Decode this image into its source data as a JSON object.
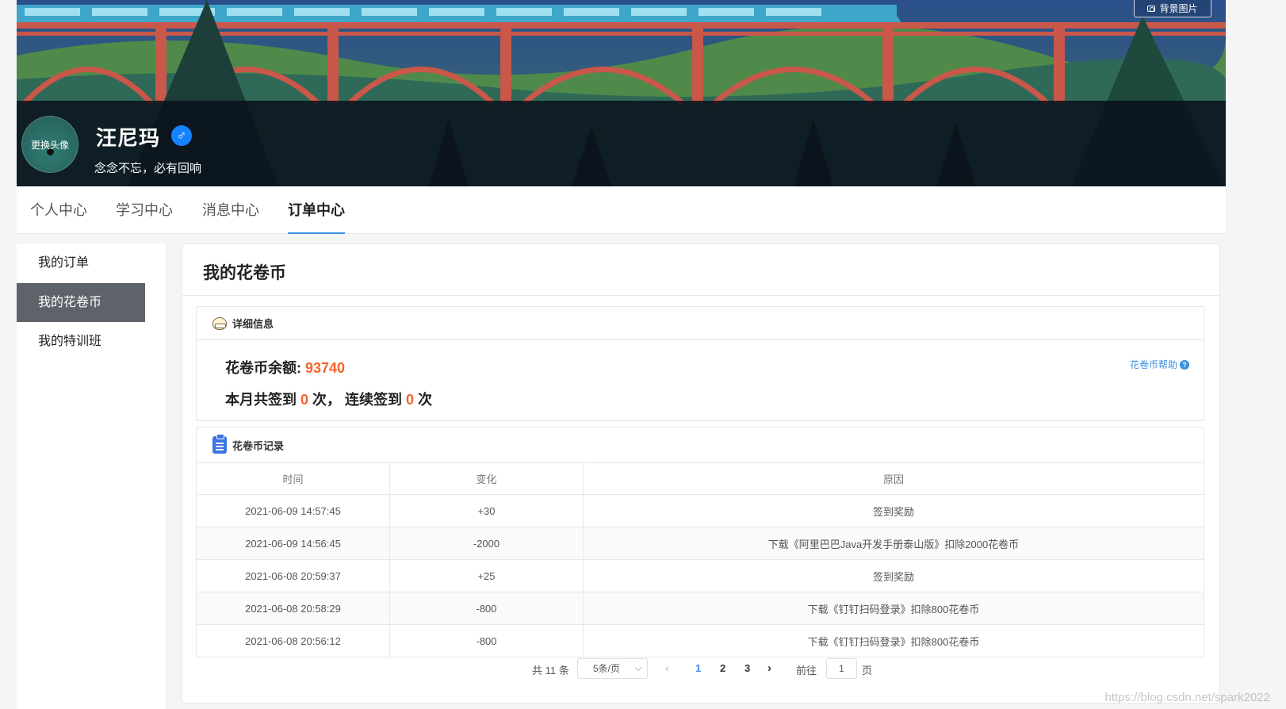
{
  "banner": {
    "bg_button_label": "背景图片"
  },
  "profile": {
    "avatar_label": "更换头像",
    "name": "汪尼玛",
    "gender_symbol": "♂",
    "motto": "念念不忘，必有回响"
  },
  "tabs": [
    {
      "label": "个人中心"
    },
    {
      "label": "学习中心"
    },
    {
      "label": "消息中心"
    },
    {
      "label": "订单中心",
      "active": true
    }
  ],
  "sidebar": {
    "items": [
      {
        "label": "我的订单"
      },
      {
        "label": "我的花卷币",
        "active": true
      },
      {
        "label": "我的特训班"
      }
    ]
  },
  "main": {
    "title": "我的花卷币",
    "detail": {
      "heading": "详细信息",
      "balance_label": "花卷币余额: ",
      "balance_value": "93740",
      "signin_prefix": "本月共签到 ",
      "signin_month": "0",
      "signin_middle": " 次， 连续签到 ",
      "signin_streak": "0",
      "signin_suffix": " 次",
      "help_link": "花卷币帮助",
      "help_icon": "?"
    },
    "records": {
      "heading": "花卷币记录",
      "columns": [
        "时间",
        "变化",
        "原因"
      ],
      "rows": [
        [
          "2021-06-09 14:57:45",
          "+30",
          "签到奖励"
        ],
        [
          "2021-06-09 14:56:45",
          "-2000",
          "下载《阿里巴巴Java开发手册泰山版》扣除2000花卷币"
        ],
        [
          "2021-06-08 20:59:37",
          "+25",
          "签到奖励"
        ],
        [
          "2021-06-08 20:58:29",
          "-800",
          "下载《钉钉扫码登录》扣除800花卷币"
        ],
        [
          "2021-06-08 20:56:12",
          "-800",
          "下载《钉钉扫码登录》扣除800花卷币"
        ]
      ]
    },
    "pagination": {
      "total": "共 11 条",
      "page_size": "5条/页",
      "prev": "‹",
      "next": "›",
      "pages": [
        "1",
        "2",
        "3"
      ],
      "current": "1",
      "goto_label": "前往",
      "goto_value": "1",
      "page_unit": "页"
    }
  },
  "watermark": "https://blog.csdn.net/spark2022"
}
